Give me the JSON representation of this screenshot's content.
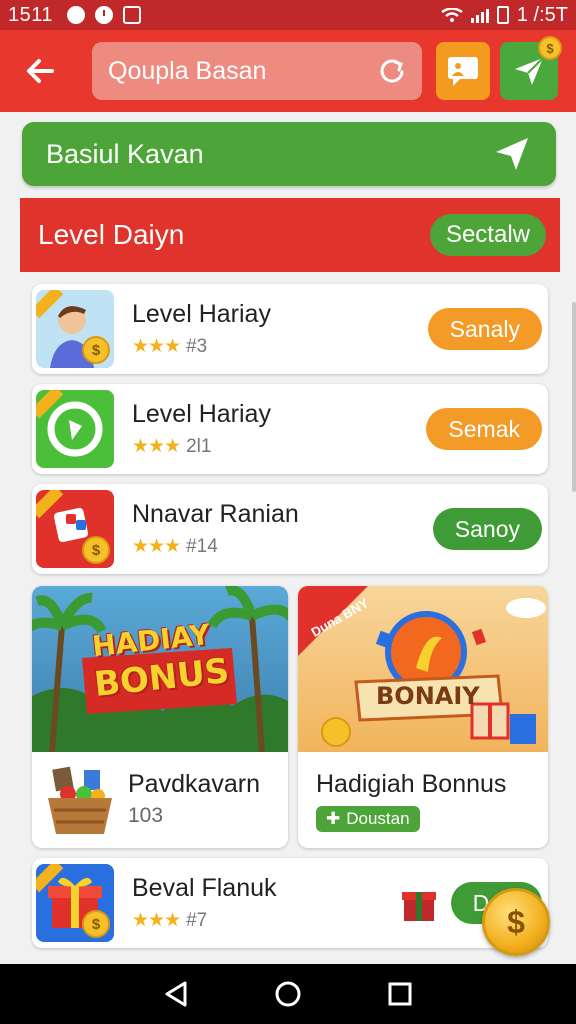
{
  "status_bar": {
    "time": "1511",
    "right_text": "1 /:5T"
  },
  "app_bar": {
    "search_placeholder": "Qoupla Basan",
    "back_icon": "back-arrow-icon",
    "refresh_icon": "refresh-icon",
    "chat_icon": "chat-icon",
    "send_icon": "send-icon",
    "accent_color": "#e8382e"
  },
  "banner": {
    "title": "Basiul Kavan"
  },
  "section": {
    "title": "Level Daiyn",
    "button": "Sectalw"
  },
  "items": [
    {
      "title": "Level Hariay",
      "stars": "★★★",
      "count": "#3",
      "action": "Sanaly",
      "action_color": "orange"
    },
    {
      "title": "Level Hariay",
      "stars": "★★★",
      "count": "2l1",
      "action": "Semak",
      "action_color": "orange"
    },
    {
      "title": "Nnavar Ranian",
      "stars": "★★★",
      "count": "#14",
      "action": "Sanoy",
      "action_color": "green"
    }
  ],
  "promos": [
    {
      "art_text_1": "HADIAY",
      "art_text_2": "BONUS",
      "title": "Pavdkavarn",
      "subtitle": "103"
    },
    {
      "art_label": "Duna BNY",
      "art_text": "BONAIY",
      "title": "Hadigiah Bonnus",
      "badge": "Doustan"
    }
  ],
  "last_item": {
    "title": "Beval Flanuk",
    "stars": "★★★",
    "count": "#7",
    "action": "De"
  },
  "fab": {
    "symbol": "$"
  }
}
